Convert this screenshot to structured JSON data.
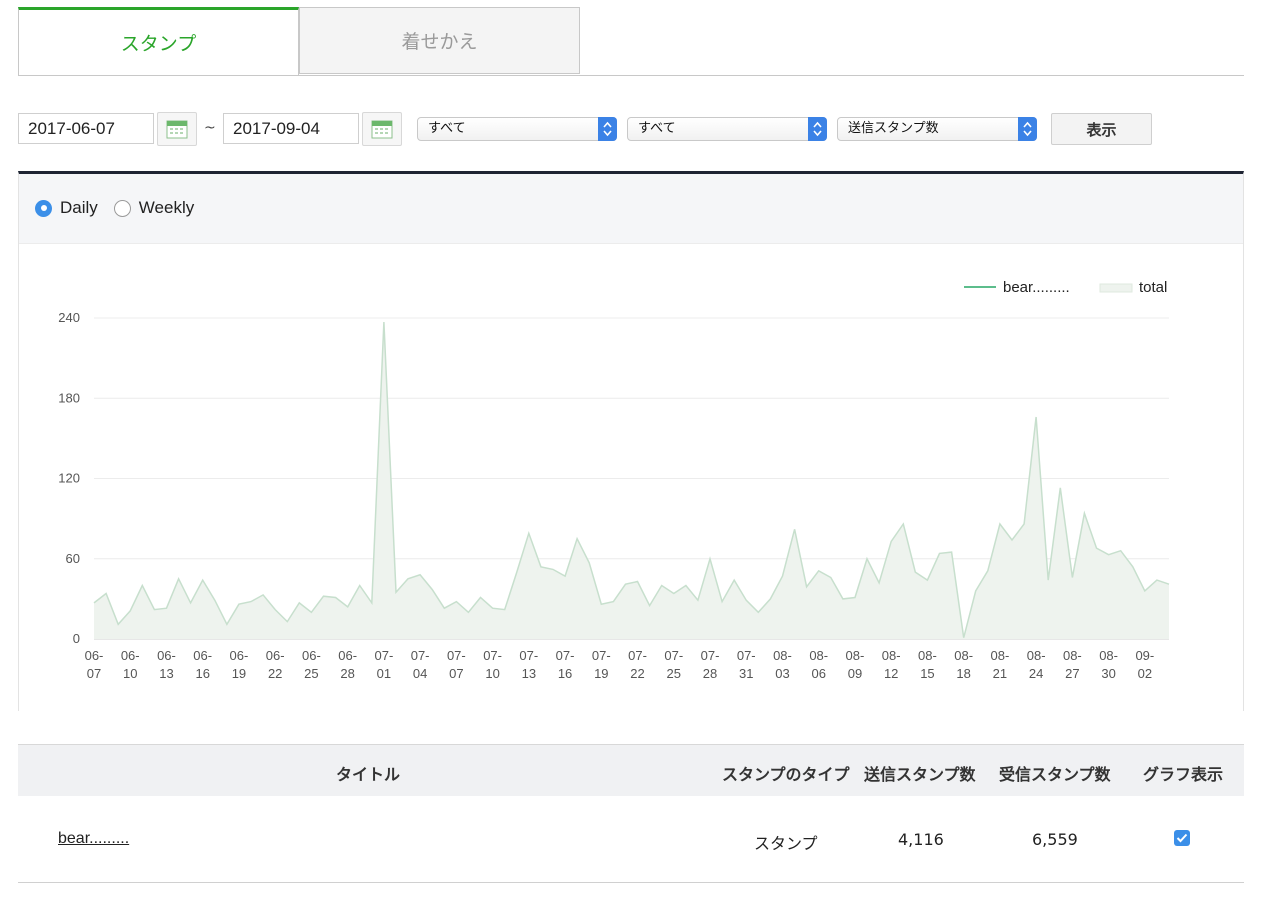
{
  "tabs": [
    {
      "label": "スタンプ",
      "active": true
    },
    {
      "label": "着せかえ",
      "active": false
    }
  ],
  "filters": {
    "start_date": "2017-06-07",
    "end_date": "2017-09-04",
    "range_separator": "~",
    "select1": "すべて",
    "select2": "すべて",
    "select3": "送信スタンプ数",
    "show_button": "表示"
  },
  "period": {
    "daily_label": "Daily",
    "weekly_label": "Weekly",
    "selected": "Daily"
  },
  "colors": {
    "accent_green": "#2aa52a",
    "line_series": "#27a766",
    "area_fill": "#eef3ee",
    "area_stroke": "#c7dfcd",
    "checkbox_blue": "#3b8fe8"
  },
  "chart_data": {
    "type": "area",
    "ylim": [
      0,
      240
    ],
    "yticks": [
      0,
      60,
      120,
      180,
      240
    ],
    "grid": true,
    "legend_position": "top-right",
    "x_start": "06-07",
    "x_tick_labels": [
      "06-07",
      "06-10",
      "06-13",
      "06-16",
      "06-19",
      "06-22",
      "06-25",
      "06-28",
      "07-01",
      "07-04",
      "07-07",
      "07-10",
      "07-13",
      "07-16",
      "07-19",
      "07-22",
      "07-25",
      "07-28",
      "07-31",
      "08-03",
      "08-06",
      "08-09",
      "08-12",
      "08-15",
      "08-18",
      "08-21",
      "08-24",
      "08-27",
      "08-30",
      "09-02"
    ],
    "series": [
      {
        "name": "bear.........",
        "style": "line",
        "values": []
      },
      {
        "name": "total",
        "style": "area",
        "values": [
          27,
          34,
          11,
          21,
          40,
          22,
          23,
          45,
          27,
          44,
          29,
          11,
          26,
          28,
          33,
          22,
          13,
          27,
          20,
          32,
          31,
          24,
          40,
          27,
          237,
          35,
          45,
          48,
          37,
          23,
          28,
          20,
          31,
          23,
          22,
          50,
          79,
          54,
          52,
          47,
          75,
          57,
          26,
          28,
          41,
          43,
          25,
          40,
          34,
          40,
          29,
          60,
          28,
          44,
          29,
          20,
          30,
          47,
          82,
          39,
          51,
          46,
          30,
          31,
          60,
          42,
          73,
          86,
          50,
          44,
          64,
          65,
          1,
          36,
          51,
          86,
          74,
          86,
          166,
          44,
          113,
          46,
          94,
          68,
          63,
          66,
          54,
          36,
          44,
          41
        ]
      }
    ]
  },
  "table": {
    "headers": {
      "title": "タイトル",
      "type": "スタンプのタイプ",
      "sent": "送信スタンプ数",
      "received": "受信スタンプ数",
      "graph": "グラフ表示"
    },
    "rows": [
      {
        "title": "bear.........",
        "type": "スタンプ",
        "sent": "4,116",
        "received": "6,559",
        "graph_checked": true
      }
    ]
  }
}
